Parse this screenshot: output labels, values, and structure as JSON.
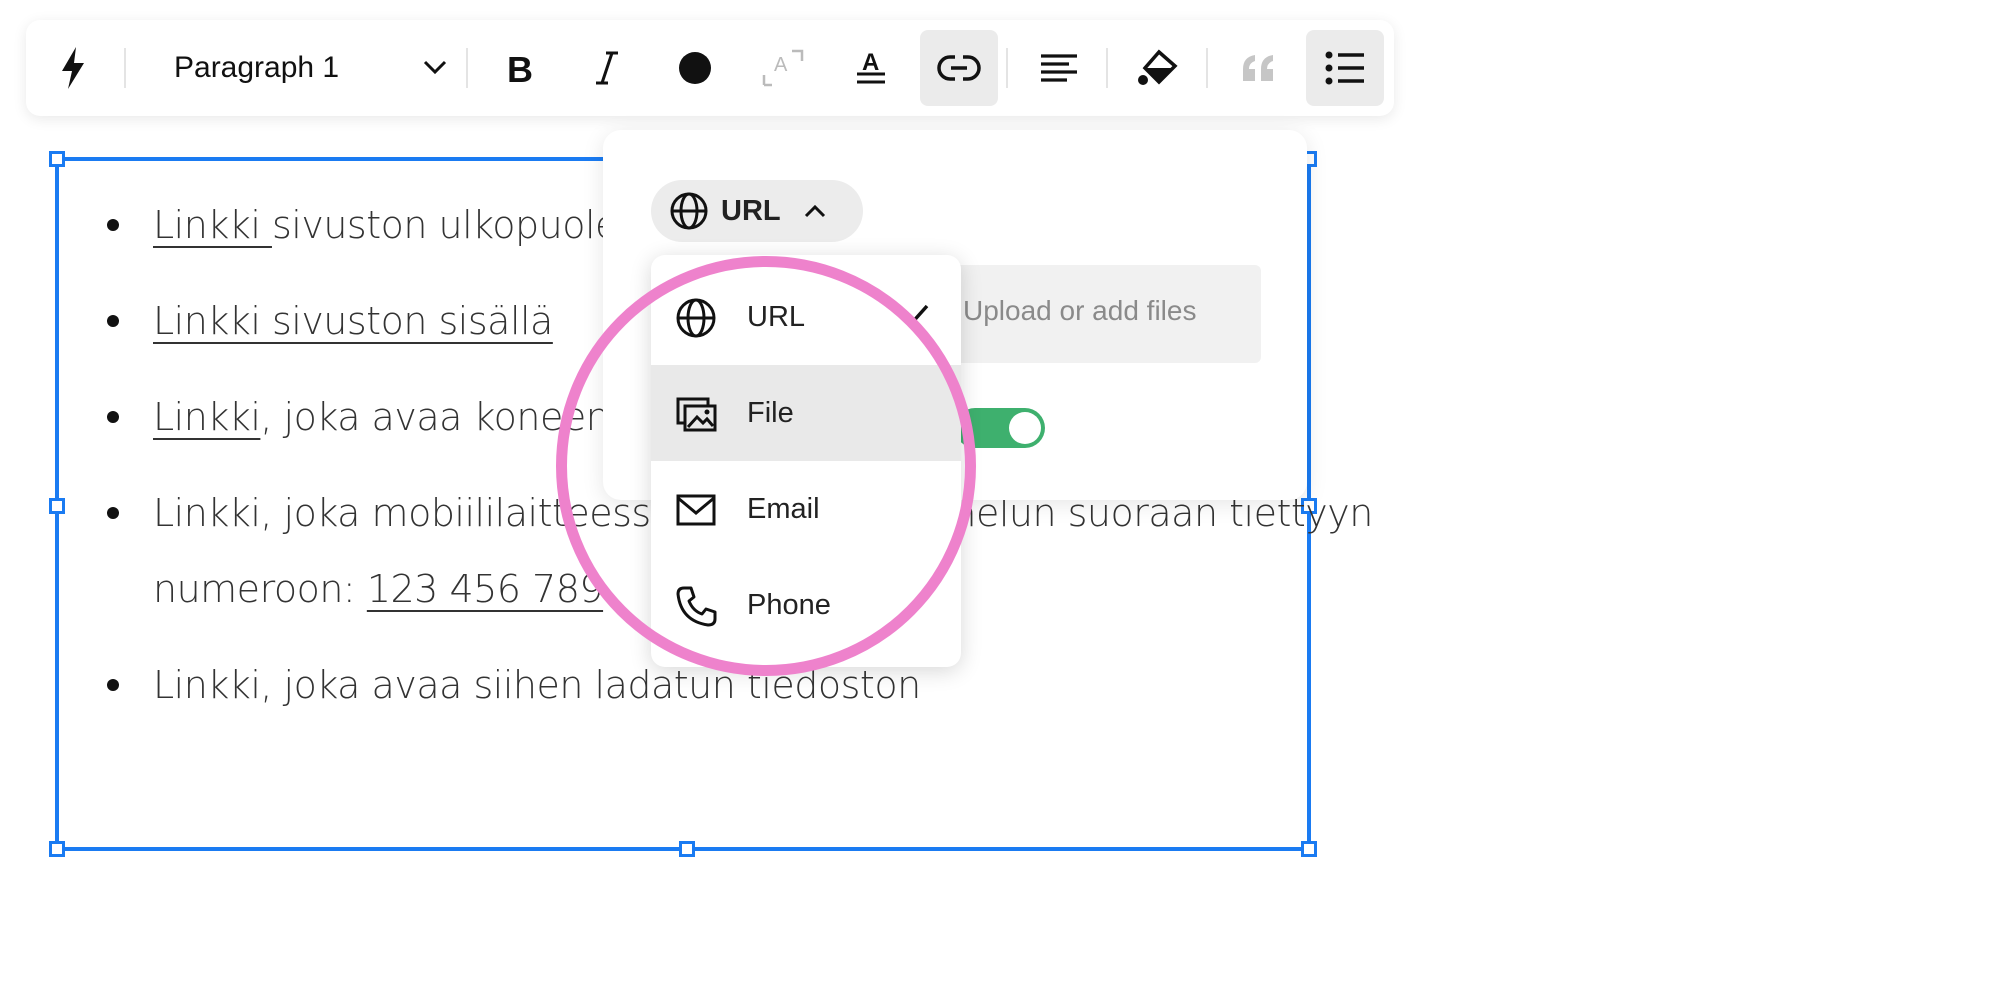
{
  "toolbar": {
    "paragraph_style": "Paragraph 1",
    "buttons": [
      "lightning-icon",
      "bold",
      "italic",
      "color",
      "text-size",
      "strikethrough",
      "link",
      "align-left",
      "fill",
      "quote",
      "bulleted-list"
    ]
  },
  "content": {
    "items": [
      {
        "link": "Linkki ",
        "text": "sivuston ulkopuolelle"
      },
      {
        "link": "Linkki sivuston sisällä",
        "text": ""
      },
      {
        "link": "Linkki",
        "text": ", joka avaa koneen"
      },
      {
        "line1": "Linkki, joka mobiililaitteessa muodostaa puhelun suoraan tiettyyn",
        "line2_prefix": "numeroon: ",
        "line2_link": "123 456 789"
      },
      {
        "link": "",
        "text": "Linkki, joka avaa siihen ladatun tiedoston"
      }
    ]
  },
  "link_panel": {
    "type_button": "URL",
    "file_placeholder": "Upload or add files",
    "toggle_on": true
  },
  "link_type_menu": {
    "items": [
      {
        "label": "URL",
        "icon": "globe-icon",
        "selected": true
      },
      {
        "label": "File",
        "icon": "image-file-icon",
        "selected": false
      },
      {
        "label": "Email",
        "icon": "envelope-icon",
        "selected": false
      },
      {
        "label": "Phone",
        "icon": "phone-icon",
        "selected": false
      }
    ]
  },
  "colors": {
    "selection": "#1a7bf2",
    "highlight": "#ee82cc",
    "toggle": "#3eb06e"
  }
}
